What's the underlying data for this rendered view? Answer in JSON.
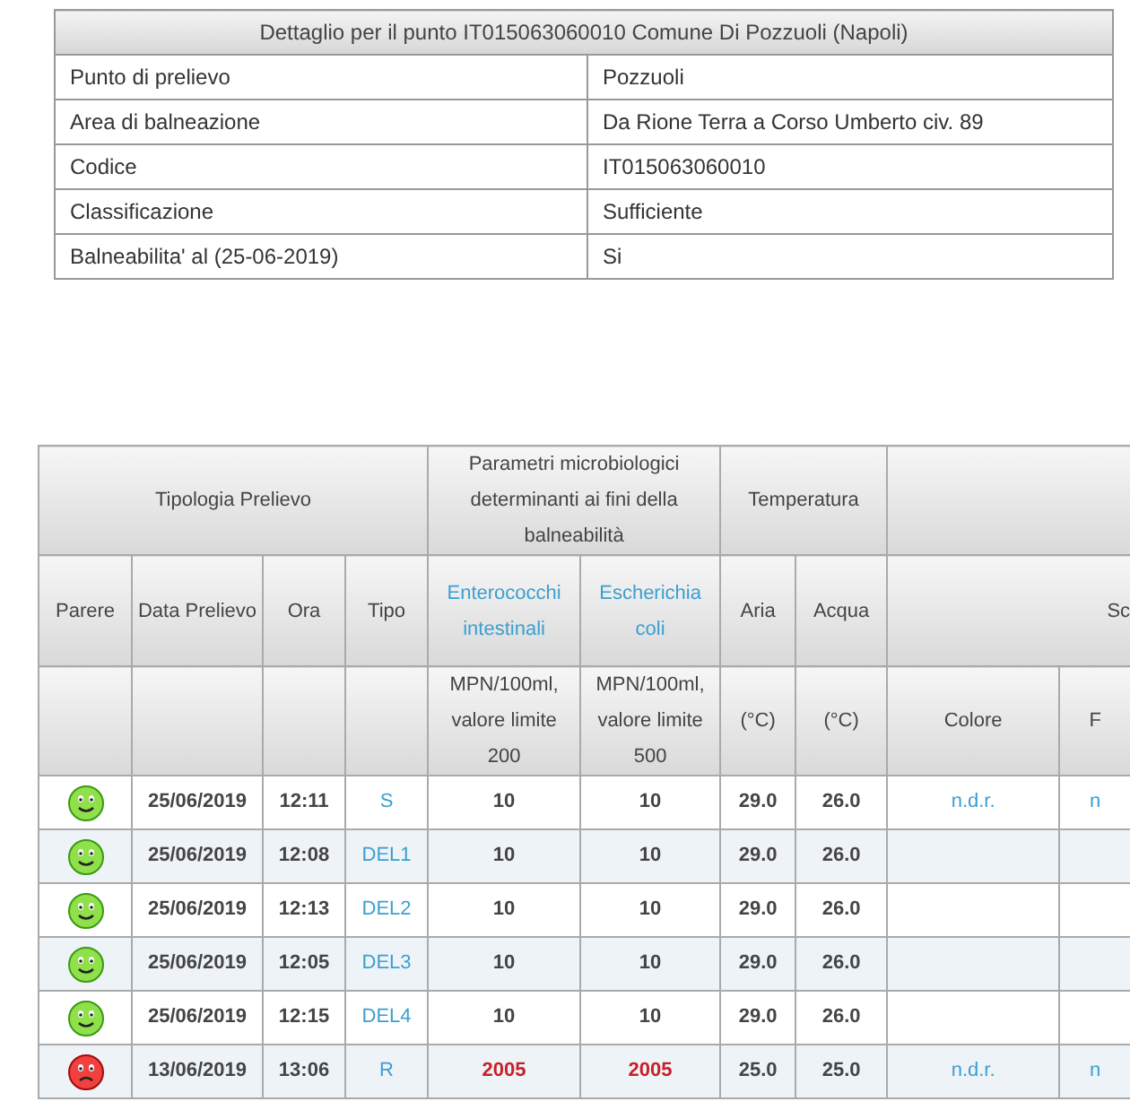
{
  "detail": {
    "title": "Dettaglio per il punto IT015063060010 Comune Di Pozzuoli (Napoli)",
    "rows": [
      {
        "label": "Punto di prelievo",
        "value": "Pozzuoli"
      },
      {
        "label": "Area di balneazione",
        "value": "Da Rione Terra a Corso Umberto civ. 89"
      },
      {
        "label": "Codice",
        "value": "IT015063060010"
      },
      {
        "label": "Classificazione",
        "value": "Sufficiente"
      },
      {
        "label": "Balneabilita' al (25-06-2019)",
        "value": "Si"
      }
    ]
  },
  "samples": {
    "groups": [
      {
        "label": "Tipologia Prelievo"
      },
      {
        "label": "Parametri microbiologici determinanti ai fini della balneabilità"
      },
      {
        "label": "Temperatura"
      }
    ],
    "columns": [
      {
        "label": "Parere",
        "kind": "plain"
      },
      {
        "label": "Data Prelievo",
        "kind": "plain"
      },
      {
        "label": "Ora",
        "kind": "plain"
      },
      {
        "label": "Tipo",
        "kind": "plain"
      },
      {
        "label": "Enterococchi intestinali",
        "kind": "link",
        "unit": "MPN/100ml, valore limite 200"
      },
      {
        "label": "Escherichia coli",
        "kind": "link",
        "unit": "MPN/100ml, valore limite 500"
      },
      {
        "label": "Aria",
        "kind": "plain",
        "unit": "(°C)"
      },
      {
        "label": "Acqua",
        "kind": "plain",
        "unit": "(°C)"
      },
      {
        "label": "Sc",
        "kind": "span2",
        "unit": "Colore"
      },
      {
        "kind": "spanned",
        "unit": "F"
      }
    ],
    "rows": [
      {
        "positive": true,
        "date": "25/06/2019",
        "time": "12:11",
        "tipo": "S",
        "enterococchi": "10",
        "escherichia": "10",
        "aria": "29.0",
        "acqua": "26.0",
        "colore": "n.d.r.",
        "column_10": "n",
        "exceeded": false
      },
      {
        "positive": true,
        "date": "25/06/2019",
        "time": "12:08",
        "tipo": "DEL1",
        "enterococchi": "10",
        "escherichia": "10",
        "aria": "29.0",
        "acqua": "26.0",
        "exceeded": false
      },
      {
        "positive": true,
        "date": "25/06/2019",
        "time": "12:13",
        "tipo": "DEL2",
        "enterococchi": "10",
        "escherichia": "10",
        "aria": "29.0",
        "acqua": "26.0",
        "exceeded": false
      },
      {
        "positive": true,
        "date": "25/06/2019",
        "time": "12:05",
        "tipo": "DEL3",
        "enterococchi": "10",
        "escherichia": "10",
        "aria": "29.0",
        "acqua": "26.0",
        "exceeded": false
      },
      {
        "positive": true,
        "date": "25/06/2019",
        "time": "12:15",
        "tipo": "DEL4",
        "enterococchi": "10",
        "escherichia": "10",
        "aria": "29.0",
        "acqua": "26.0",
        "exceeded": false
      },
      {
        "positive": false,
        "date": "13/06/2019",
        "time": "13:06",
        "tipo": "R",
        "enterococchi": "2005",
        "escherichia": "2005",
        "aria": "25.0",
        "acqua": "25.0",
        "colore": "n.d.r.",
        "column_10": "n",
        "exceeded": true
      }
    ]
  }
}
